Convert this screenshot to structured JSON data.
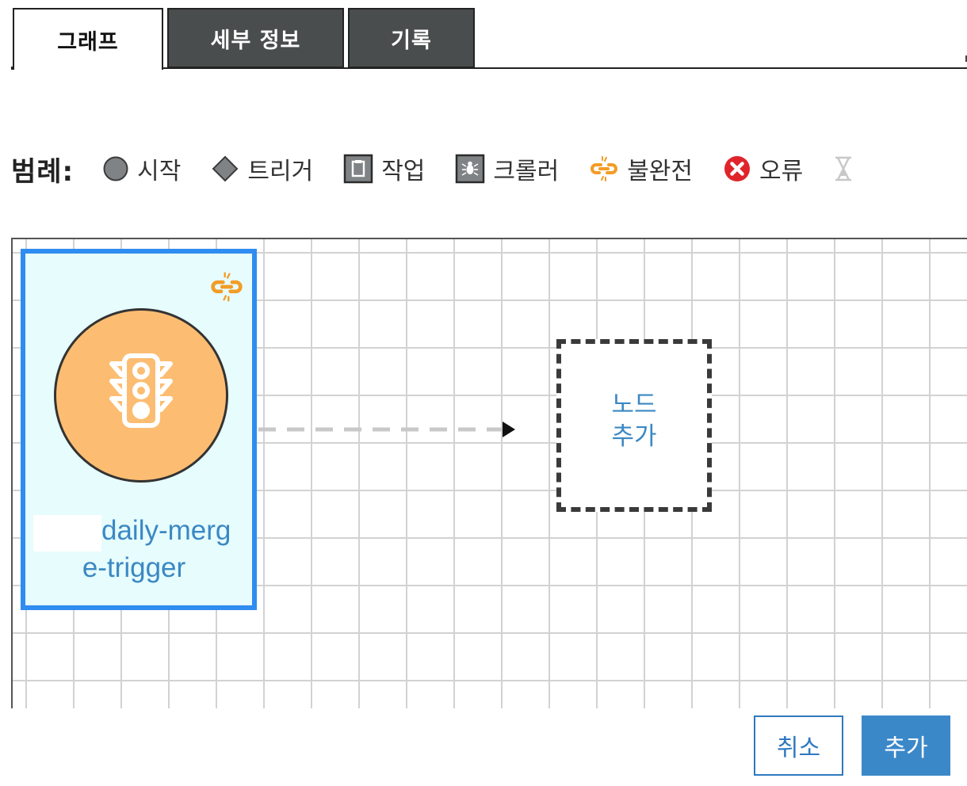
{
  "tabs": [
    {
      "label": "그래프",
      "active": true
    },
    {
      "label": "세부 정보",
      "active": false
    },
    {
      "label": "기록",
      "active": false
    }
  ],
  "legend": {
    "title": "범례:",
    "items": [
      {
        "label": "시작",
        "icon": "circle-icon"
      },
      {
        "label": "트리거",
        "icon": "diamond-icon"
      },
      {
        "label": "작업",
        "icon": "clipboard-icon"
      },
      {
        "label": "크롤러",
        "icon": "crawler-icon"
      },
      {
        "label": "불완전",
        "icon": "broken-link-icon"
      },
      {
        "label": "오류",
        "icon": "error-x-icon"
      },
      {
        "label": "",
        "icon": "hourglass-icon"
      }
    ]
  },
  "graph": {
    "trigger_node": {
      "name_line1": "daily-merg",
      "name_line2": "e-trigger",
      "icon": "traffic-light-icon",
      "status_icon": "broken-link-icon",
      "selected": true
    },
    "add_node": {
      "line1": "노드",
      "line2": "추가"
    }
  },
  "buttons": {
    "cancel": "취소",
    "add": "추가"
  },
  "colors": {
    "accent": "#3b88c3",
    "selection_border": "#2f8cf0",
    "node_fill": "#e6fcfd",
    "trigger_circle": "#fcbd72",
    "incomplete": "#f39c26",
    "error": "#e0242b",
    "tab_dark": "#4a4d4d"
  }
}
